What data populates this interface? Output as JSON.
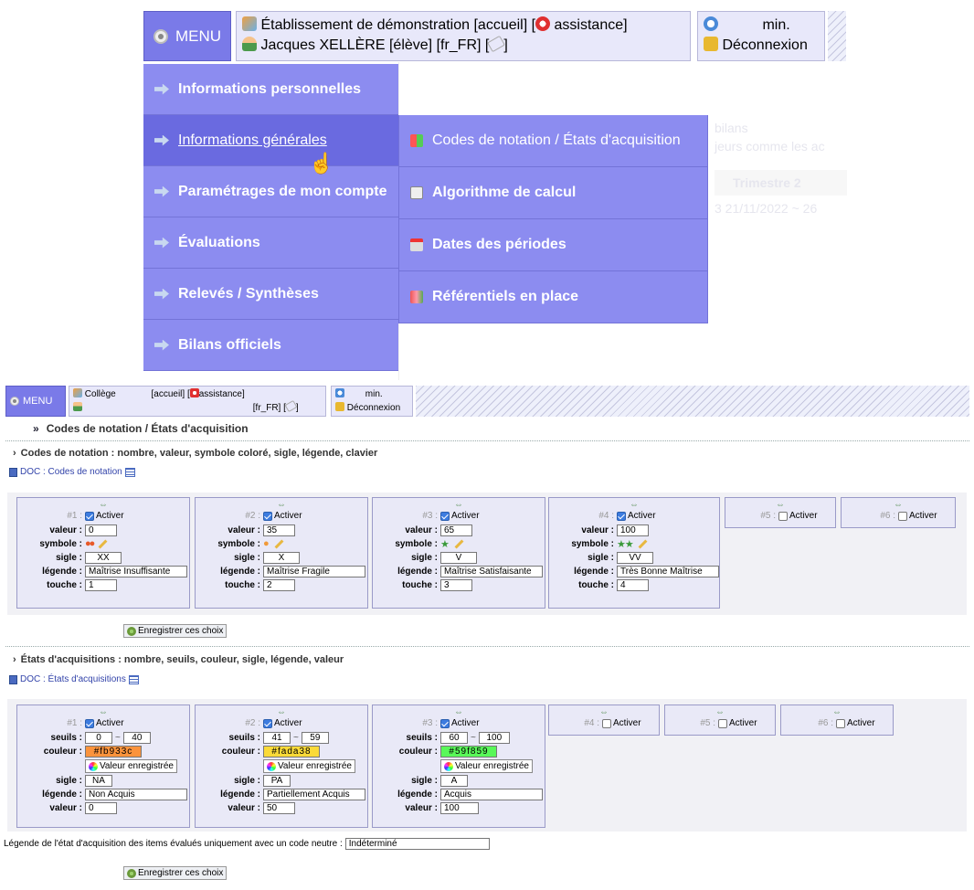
{
  "zoom": {
    "menu_label": "MENU",
    "establishment": "Établissement de démonstration [accueil] [",
    "assistance": "assistance]",
    "user": "Jacques XELLÈRE [élève] [fr_FR] [",
    "user_end": "]",
    "time_unit": "min.",
    "logout": "Déconnexion",
    "menu_items": [
      {
        "label": "Informations personnelles"
      },
      {
        "label": "Informations générales"
      },
      {
        "label": "Paramétrages de mon compte"
      },
      {
        "label": "Évaluations"
      },
      {
        "label": "Relevés / Synthèses"
      },
      {
        "label": "Bilans officiels"
      }
    ],
    "submenu_items": [
      {
        "label": "Codes de notation / États d'acquisition",
        "icon": "grid-icon"
      },
      {
        "label": "Algorithme de calcul",
        "icon": "calculator-icon"
      },
      {
        "label": "Dates des périodes",
        "icon": "calendar-icon"
      },
      {
        "label": "Référentiels en place",
        "icon": "books-icon"
      }
    ],
    "ghost": {
      "a": "bilans",
      "b": "jeurs comme les ac",
      "c": "Trimestre 2",
      "d": "3 21/11/2022 ~ 26"
    }
  },
  "header": {
    "menu_label": "MENU",
    "establishment_a": "Collège",
    "establishment_b": "[accueil] [",
    "assistance": "assistance]",
    "user_tail": "[fr_FR] [",
    "user_end": "]",
    "time_unit": "min.",
    "logout": "Déconnexion"
  },
  "page": {
    "title": "Codes de notation / États d'acquisition",
    "codes": {
      "section_title": "Codes de notation : nombre, valeur, symbole coloré, sigle, légende, clavier",
      "doc_link": "DOC : Codes de notation",
      "labels": {
        "valeur": "valeur :",
        "symbole": "symbole :",
        "sigle": "sigle :",
        "legende": "légende :",
        "touche": "touche :"
      },
      "activate_label": "Activer",
      "cards": [
        {
          "num": "#1 :",
          "active": true,
          "valeur": "0",
          "sigle": "XX",
          "legende": "Maîtrise Insuffisante",
          "touche": "1",
          "symbol": "●●",
          "symbol_color": "#e85a2a"
        },
        {
          "num": "#2 :",
          "active": true,
          "valeur": "35",
          "sigle": "X",
          "legende": "Maîtrise Fragile",
          "touche": "2",
          "symbol": "●",
          "symbol_color": "#f09a3a"
        },
        {
          "num": "#3 :",
          "active": true,
          "valeur": "65",
          "sigle": "V",
          "legende": "Maîtrise Satisfaisante",
          "touche": "3",
          "symbol": "★",
          "symbol_color": "#3a9a3a"
        },
        {
          "num": "#4 :",
          "active": true,
          "valeur": "100",
          "sigle": "VV",
          "legende": "Très Bonne Maîtrise",
          "touche": "4",
          "symbol": "★★",
          "symbol_color": "#3a9a3a"
        },
        {
          "num": "#5 :",
          "active": false
        },
        {
          "num": "#6 :",
          "active": false
        }
      ],
      "save_label": "Enregistrer ces choix"
    },
    "etats": {
      "section_title": "États d'acquisitions : nombre, seuils, couleur, sigle, légende, valeur",
      "doc_link": "DOC : États d'acquisitions",
      "labels": {
        "seuils": "seuils :",
        "couleur": "couleur :",
        "sigle": "sigle :",
        "legende": "légende :",
        "valeur": "valeur :"
      },
      "activate_label": "Activer",
      "saved_value_label": "Valeur enregistrée",
      "cards": [
        {
          "num": "#1 :",
          "active": true,
          "seuil_min": "0",
          "seuil_max": "40",
          "couleur": "#fb933c",
          "sigle": "NA",
          "legende": "Non Acquis",
          "valeur": "0"
        },
        {
          "num": "#2 :",
          "active": true,
          "seuil_min": "41",
          "seuil_max": "59",
          "couleur": "#fada38",
          "sigle": "PA",
          "legende": "Partiellement Acquis",
          "valeur": "50"
        },
        {
          "num": "#3 :",
          "active": true,
          "seuil_min": "60",
          "seuil_max": "100",
          "couleur": "#59f859",
          "sigle": "A",
          "legende": "Acquis",
          "valeur": "100"
        },
        {
          "num": "#4 :",
          "active": false
        },
        {
          "num": "#5 :",
          "active": false
        },
        {
          "num": "#6 :",
          "active": false
        }
      ],
      "neutral_label": "Légende de l'état d'acquisition des items évalués uniquement avec un code neutre :",
      "neutral_value": "Indéterminé",
      "save_label": "Enregistrer ces choix"
    }
  }
}
